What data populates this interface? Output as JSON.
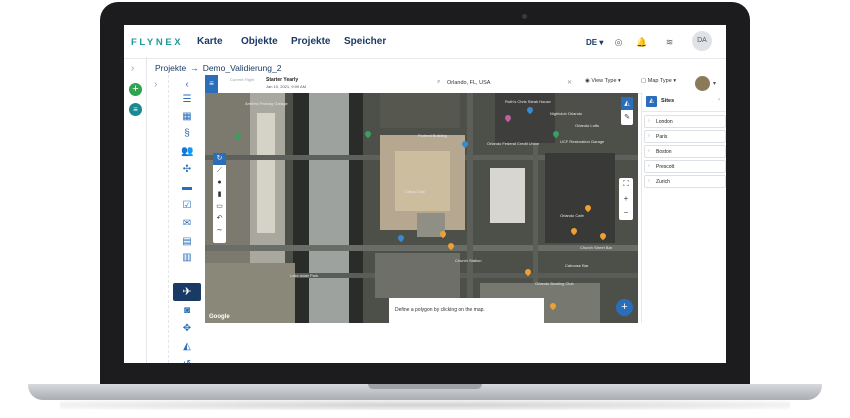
{
  "app": {
    "logo": "FLYNEX",
    "nav": [
      "Karte",
      "Objekte",
      "Projekte",
      "Speicher"
    ],
    "language": "DE",
    "user_initials": "DA",
    "icons": [
      "help-icon",
      "bell-icon",
      "wifi-icon"
    ]
  },
  "breadcrumb": {
    "root": "Projekte",
    "arrow": "→",
    "current": "Demo_Validierung_2"
  },
  "map_toolbar": {
    "flight_label": "Current Flight",
    "flight_name": "Starter Yearly",
    "flight_date": "Jan 10, 2021, 9:09 AM",
    "search_value": "Orlando, FL, USA",
    "view_type_label": "View Type",
    "map_type_label": "Map Type"
  },
  "map": {
    "labels": [
      "Arnfield Parking Garage",
      "Federal Building",
      "Orlando Federal Credit Union",
      "UCF Restoration Garage",
      "Ruth's Chris Steak House",
      "Nightclub Orlando",
      "Orlando Lofts",
      "Church Street Bar",
      "Lake Adair Park",
      "Citrus Club",
      "Orlando Cafe",
      "Caboose Bar",
      "Church Station",
      "Orlando Bowling Club"
    ],
    "hint": "Define a polygon by clicking on the map.",
    "attribution": "Google"
  },
  "sites": {
    "title": "Sites",
    "items": [
      "London",
      "Paris",
      "Boston",
      "Prescott",
      "Zurich"
    ]
  }
}
